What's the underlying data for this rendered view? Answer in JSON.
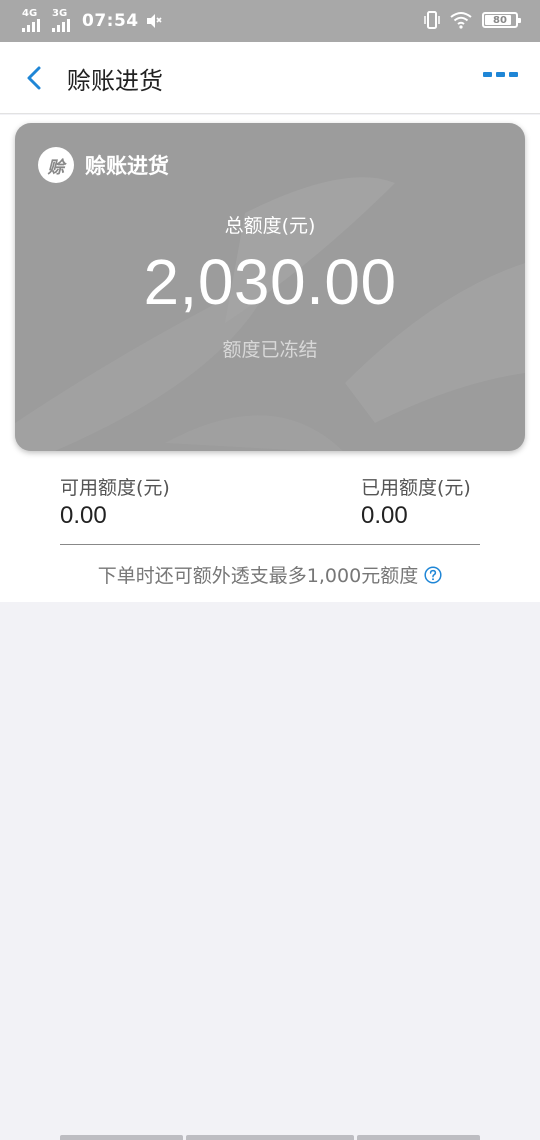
{
  "status_bar": {
    "network1": "4G",
    "network2": "3G",
    "time": "07:54",
    "battery": "80"
  },
  "nav": {
    "title": "赊账进货",
    "back_icon": "chevron-left-icon",
    "more_icon": "more-dots-icon"
  },
  "card": {
    "name": "赊账进货",
    "logo_text": "赊",
    "total_label": "总额度(元)",
    "total_amount": "2,030.00",
    "status": "额度已冻结",
    "background_color": "#9c9c9c"
  },
  "quota": {
    "available_label": "可用额度(元)",
    "available_value": "0.00",
    "used_label": "已用额度(元)",
    "used_value": "0.00"
  },
  "note": {
    "text": "下单时还可额外透支最多1,000元额度",
    "help_icon": "question-circle-icon"
  },
  "colors": {
    "accent": "#1f86d6",
    "status_bar": "#a8a8a8",
    "page_bg": "#f2f2f6"
  }
}
